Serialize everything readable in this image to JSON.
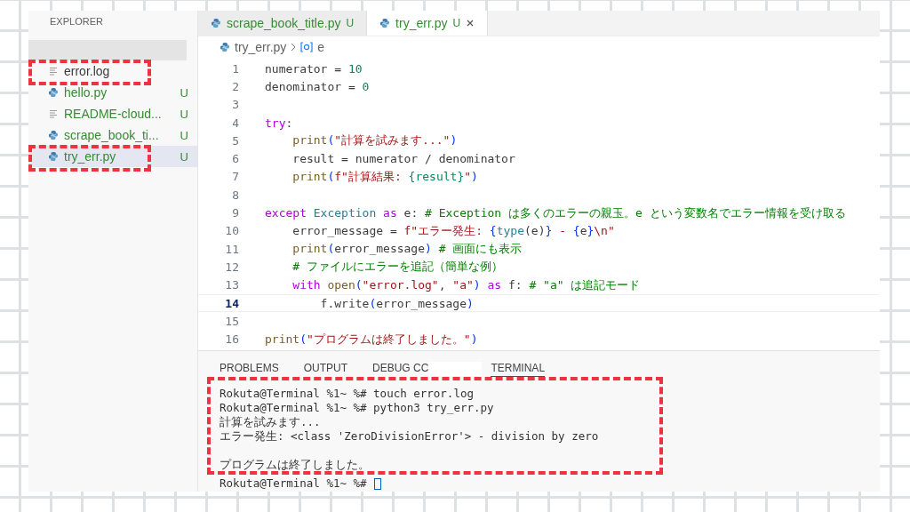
{
  "sidebar": {
    "title": "EXPLORER",
    "items": [
      {
        "name": "error.log",
        "kind": "text",
        "selected": false
      },
      {
        "name": "hello.py",
        "kind": "python",
        "status": "U",
        "selected": false
      },
      {
        "name": "README-cloud...",
        "kind": "text",
        "status": "U",
        "selected": false
      },
      {
        "name": "scrape_book_ti...",
        "kind": "python",
        "status": "U",
        "selected": false
      },
      {
        "name": "try_err.py",
        "kind": "python",
        "status": "U",
        "selected": true
      }
    ]
  },
  "tabs": [
    {
      "label": "scrape_book_title.py",
      "status": "U",
      "selected": false
    },
    {
      "label": "try_err.py",
      "status": "U",
      "selected": true
    }
  ],
  "breadcrumb": {
    "file": "try_err.py",
    "symbol": "e"
  },
  "code": [
    {
      "number": "1",
      "current": false,
      "tokens": [
        {
          "text": "numerator = ",
          "kind": "plain"
        },
        {
          "text": "10",
          "kind": "num"
        }
      ]
    },
    {
      "number": "2",
      "current": false,
      "tokens": [
        {
          "text": "denominator = ",
          "kind": "plain"
        },
        {
          "text": "0",
          "kind": "num"
        }
      ]
    },
    {
      "number": "3",
      "current": false
    },
    {
      "number": "4",
      "current": false,
      "tokens": [
        {
          "text": "try",
          "kind": "kw"
        },
        {
          "text": ":",
          "kind": "plain"
        }
      ]
    },
    {
      "number": "5",
      "current": false,
      "tokens": [
        {
          "text": "    print",
          "kind": "fn"
        },
        {
          "text": "(",
          "kind": "paren"
        },
        {
          "text": "\"計算を試みます...\"",
          "kind": "str"
        },
        {
          "text": ")",
          "kind": "paren"
        }
      ]
    },
    {
      "number": "6",
      "current": false,
      "tokens": [
        {
          "text": "    result = numerator / denominator",
          "kind": "plain"
        }
      ]
    },
    {
      "number": "7",
      "current": false,
      "tokens": [
        {
          "text": "    print",
          "kind": "fn"
        },
        {
          "text": "(",
          "kind": "paren"
        },
        {
          "text": "f\"計算結果: ",
          "kind": "str"
        },
        {
          "text": "{result}",
          "kind": "num"
        },
        {
          "text": "\"",
          "kind": "str"
        },
        {
          "text": ")",
          "kind": "paren"
        }
      ]
    },
    {
      "number": "8",
      "current": false
    },
    {
      "number": "9",
      "current": false,
      "tokens": [
        {
          "text": "except ",
          "kind": "kw"
        },
        {
          "text": "Exception",
          "kind": "cls"
        },
        {
          "text": " as ",
          "kind": "kw"
        },
        {
          "text": "e: ",
          "kind": "plain"
        },
        {
          "text": "# Exception は多くのエラーの親玉。e という変数名でエラー情報を受け取る",
          "kind": "com"
        }
      ]
    },
    {
      "number": "10",
      "current": false,
      "tokens": [
        {
          "text": "    error_message = ",
          "kind": "plain"
        },
        {
          "text": "f\"エラー発生: ",
          "kind": "str"
        },
        {
          "text": "{",
          "kind": "paren"
        },
        {
          "text": "type",
          "kind": "cls"
        },
        {
          "text": "(e)",
          "kind": "plain"
        },
        {
          "text": "}",
          "kind": "paren"
        },
        {
          "text": " - ",
          "kind": "str"
        },
        {
          "text": "{",
          "kind": "paren"
        },
        {
          "text": "e",
          "kind": "plain"
        },
        {
          "text": "}",
          "kind": "paren"
        },
        {
          "text": "\\n\"",
          "kind": "str"
        }
      ]
    },
    {
      "number": "11",
      "current": false,
      "tokens": [
        {
          "text": "    print",
          "kind": "fn"
        },
        {
          "text": "(",
          "kind": "paren"
        },
        {
          "text": "error_message",
          "kind": "plain"
        },
        {
          "text": ")",
          "kind": "paren"
        },
        {
          "text": " # 画面にも表示",
          "kind": "com"
        }
      ]
    },
    {
      "number": "12",
      "current": false,
      "tokens": [
        {
          "text": "    # ファイルにエラーを追記（簡単な例）",
          "kind": "com"
        }
      ]
    },
    {
      "number": "13",
      "current": false,
      "tokens": [
        {
          "text": "    with ",
          "kind": "kw"
        },
        {
          "text": "open",
          "kind": "fn"
        },
        {
          "text": "(",
          "kind": "paren"
        },
        {
          "text": "\"error.log\"",
          "kind": "str"
        },
        {
          "text": ", ",
          "kind": "plain"
        },
        {
          "text": "\"a\"",
          "kind": "str"
        },
        {
          "text": ")",
          "kind": "paren"
        },
        {
          "text": " as ",
          "kind": "kw"
        },
        {
          "text": "f: ",
          "kind": "plain"
        },
        {
          "text": "# \"a\" は追記モード",
          "kind": "com"
        }
      ]
    },
    {
      "number": "14",
      "current": true,
      "tokens": [
        {
          "text": "        f.write",
          "kind": "plain"
        },
        {
          "text": "(",
          "kind": "paren"
        },
        {
          "text": "error_message",
          "kind": "plain"
        },
        {
          "text": ")",
          "kind": "paren"
        }
      ]
    },
    {
      "number": "15",
      "current": false
    },
    {
      "number": "16",
      "current": false,
      "tokens": [
        {
          "text": "print",
          "kind": "fn"
        },
        {
          "text": "(",
          "kind": "paren"
        },
        {
          "text": "\"プログラムは終了しました。\"",
          "kind": "str"
        },
        {
          "text": ")",
          "kind": "paren"
        }
      ]
    }
  ],
  "panel": {
    "tabs": [
      {
        "label": "PROBLEMS",
        "selected": false
      },
      {
        "label": "OUTPUT",
        "selected": false
      },
      {
        "label": "DEBUG CC",
        "selected": false,
        "redacted": true
      },
      {
        "label": "TERMINAL",
        "selected": true
      }
    ],
    "terminal": [
      {
        "text": "Rokuta@Terminal %1~ %# touch error.log",
        "blank_before": false
      },
      {
        "text": "Rokuta@Terminal %1~ %# python3 try_err.py",
        "blank_before": false
      },
      {
        "text": "計算を試みます...",
        "blank_before": false
      },
      {
        "text": "エラー発生: <class 'ZeroDivisionError'> - division by zero",
        "blank_before": false
      },
      {
        "text": "プログラムは終了しました。",
        "blank_before": true
      }
    ],
    "prompt": "Rokuta@Terminal %1~ %#"
  }
}
